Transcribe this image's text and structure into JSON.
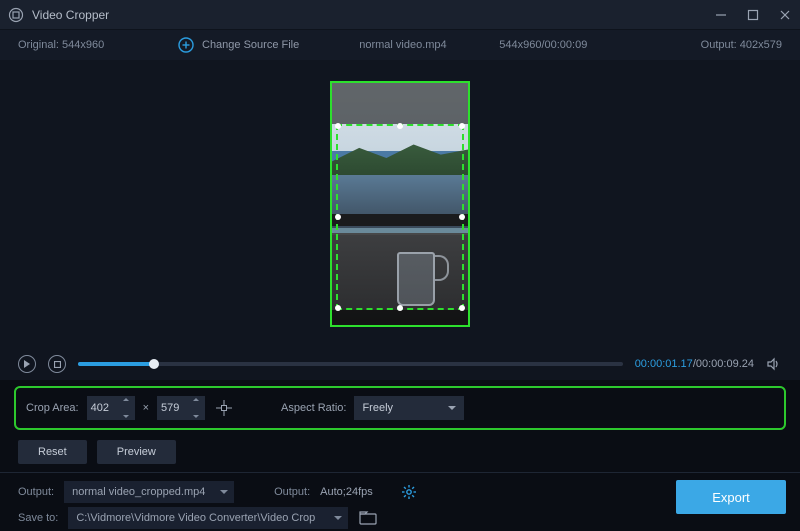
{
  "titlebar": {
    "title": "Video Cropper"
  },
  "infobar": {
    "original_label": "Original:",
    "original_dims": "544x960",
    "change_source_label": "Change Source File",
    "filename": "normal video.mp4",
    "source_dims_time": "544x960/00:00:09",
    "output_label": "Output:",
    "output_dims": "402x579"
  },
  "playback": {
    "current_time": "00:00:01.17",
    "total_time": "00:00:09.24"
  },
  "crop": {
    "area_label": "Crop Area:",
    "width": "402",
    "height": "579",
    "times": "×",
    "aspect_label": "Aspect Ratio:",
    "aspect_value": "Freely"
  },
  "actions": {
    "reset_label": "Reset",
    "preview_label": "Preview"
  },
  "output": {
    "output_label": "Output:",
    "output_filename": "normal video_cropped.mp4",
    "format_label": "Output:",
    "format_value": "Auto;24fps",
    "save_to_label": "Save to:",
    "save_to_path": "C:\\Vidmore\\Vidmore Video Converter\\Video Crop"
  },
  "export": {
    "label": "Export"
  }
}
